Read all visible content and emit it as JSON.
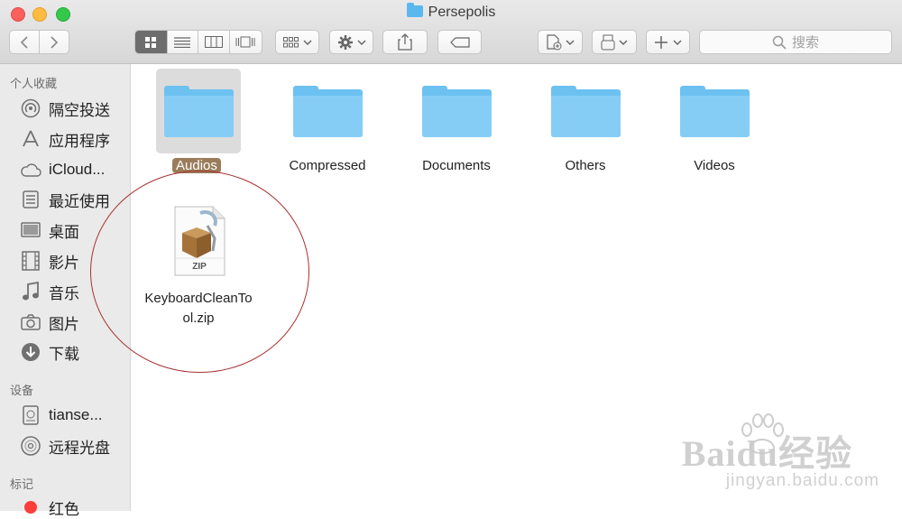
{
  "window": {
    "title": "Persepolis"
  },
  "toolbar": {
    "back_icon": "chevron-left-icon",
    "forward_icon": "chevron-right-icon",
    "view_icons": [
      "icon-view-icon",
      "list-view-icon",
      "column-view-icon",
      "coverflow-view-icon"
    ],
    "search_placeholder": "搜索"
  },
  "sidebar": {
    "favorites_header": "个人收藏",
    "favorites": [
      {
        "label": "隔空投送",
        "icon": "airdrop-icon"
      },
      {
        "label": "应用程序",
        "icon": "applications-icon"
      },
      {
        "label": "iCloud...",
        "icon": "cloud-icon"
      },
      {
        "label": "最近使用",
        "icon": "recents-icon"
      },
      {
        "label": "桌面",
        "icon": "desktop-icon"
      },
      {
        "label": "影片",
        "icon": "movies-icon"
      },
      {
        "label": "音乐",
        "icon": "music-icon"
      },
      {
        "label": "图片",
        "icon": "camera-icon"
      },
      {
        "label": "下载",
        "icon": "download-icon"
      }
    ],
    "devices_header": "设备",
    "devices": [
      {
        "label": "tianse...",
        "icon": "disk-icon"
      },
      {
        "label": "远程光盘",
        "icon": "optical-disc-icon"
      }
    ],
    "tags_header": "标记",
    "tags": [
      {
        "label": "红色",
        "color": "#fc3d39"
      }
    ]
  },
  "files": {
    "folders": [
      {
        "label": "Audios",
        "selected": true
      },
      {
        "label": "Compressed"
      },
      {
        "label": "Documents"
      },
      {
        "label": "Others"
      },
      {
        "label": "Videos"
      }
    ],
    "zip": {
      "label_line1": "KeyboardCleanTo",
      "label_line2": "ol.zip",
      "badge": "ZIP"
    }
  },
  "watermark": {
    "brand": "Baidu经验",
    "url": "jingyan.baidu.com"
  },
  "colors": {
    "folder": "#6cc1f1",
    "selection": "#9a7c5a",
    "annotation_circle": "#a83232"
  }
}
